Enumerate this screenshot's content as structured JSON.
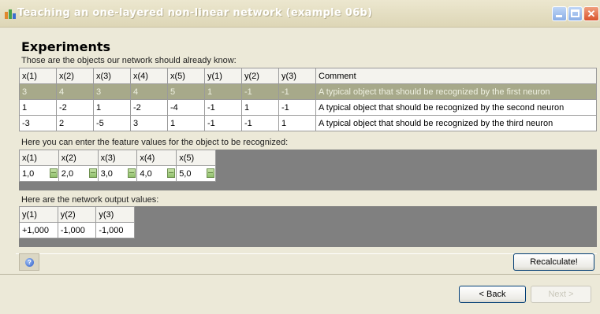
{
  "window": {
    "title": "Teaching an one-layered non-linear network (example 06b)"
  },
  "heading": "Experiments",
  "known_objects": {
    "caption": "Those are the objects our network should already know:",
    "columns": [
      "x(1)",
      "x(2)",
      "x(3)",
      "x(4)",
      "x(5)",
      "y(1)",
      "y(2)",
      "y(3)",
      "Comment"
    ],
    "rows": [
      [
        "3",
        "4",
        "3",
        "4",
        "5",
        "1",
        "-1",
        "-1",
        "A typical object that should be recognized by the first neuron"
      ],
      [
        "1",
        "-2",
        "1",
        "-2",
        "-4",
        "-1",
        "1",
        "-1",
        "A typical object that should be recognized by the second neuron"
      ],
      [
        "-3",
        "2",
        "-5",
        "3",
        "1",
        "-1",
        "-1",
        "1",
        "A typical object that should be recognized by the third neuron"
      ]
    ],
    "selected_row": 0
  },
  "features": {
    "caption": "Here you can enter the feature values for the object to be recognized:",
    "columns": [
      "x(1)",
      "x(2)",
      "x(3)",
      "x(4)",
      "x(5)"
    ],
    "values": [
      "1,0",
      "2,0",
      "3,0",
      "4,0",
      "5,0"
    ]
  },
  "outputs": {
    "caption": "Here are the network output values:",
    "columns": [
      "y(1)",
      "y(2)",
      "y(3)"
    ],
    "values": [
      "+1,000",
      "-1,000",
      "-1,000"
    ]
  },
  "buttons": {
    "recalculate": "Recalculate!",
    "back": "< Back",
    "next": "Next >"
  },
  "icons": {
    "app": "app-icon",
    "help": "help-icon",
    "minimize": "minimize-icon",
    "maximize": "maximize-icon",
    "close": "close-icon"
  },
  "colors": {
    "selected_row": "#a7a98a",
    "panel": "#808080",
    "close": "#d9542c"
  }
}
